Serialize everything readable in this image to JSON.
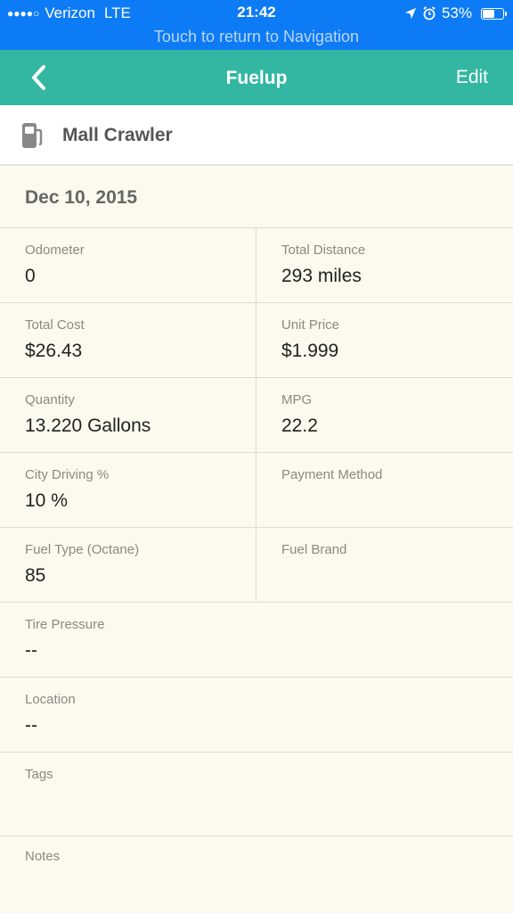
{
  "status_bar": {
    "carrier": "Verizon",
    "network": "LTE",
    "time": "21:42",
    "battery": "53%",
    "battery_level": 0.53,
    "return_text": "Touch to return to Navigation"
  },
  "nav": {
    "title": "Fuelup",
    "edit_label": "Edit"
  },
  "vehicle": {
    "name": "Mall Crawler"
  },
  "entry": {
    "date": "Dec 10, 2015"
  },
  "fields": {
    "odometer": {
      "label": "Odometer",
      "value": "0"
    },
    "total_distance": {
      "label": "Total Distance",
      "value": "293 miles"
    },
    "total_cost": {
      "label": "Total Cost",
      "value": "$26.43"
    },
    "unit_price": {
      "label": "Unit Price",
      "value": "$1.999"
    },
    "quantity": {
      "label": "Quantity",
      "value": "13.220 Gallons"
    },
    "mpg": {
      "label": "MPG",
      "value": "22.2"
    },
    "city_driving": {
      "label": "City Driving %",
      "value": "10 %"
    },
    "payment_method": {
      "label": "Payment Method",
      "value": ""
    },
    "fuel_type": {
      "label": "Fuel Type (Octane)",
      "value": "85"
    },
    "fuel_brand": {
      "label": "Fuel Brand",
      "value": ""
    },
    "tire_pressure": {
      "label": "Tire Pressure",
      "value": "--"
    },
    "location": {
      "label": "Location",
      "value": "--"
    },
    "tags": {
      "label": "Tags",
      "value": ""
    },
    "notes": {
      "label": "Notes",
      "value": ""
    }
  },
  "colors": {
    "status_bar_bg": "#0d7bf5",
    "nav_bg": "#33b7a3",
    "content_bg": "#fbfaee"
  }
}
